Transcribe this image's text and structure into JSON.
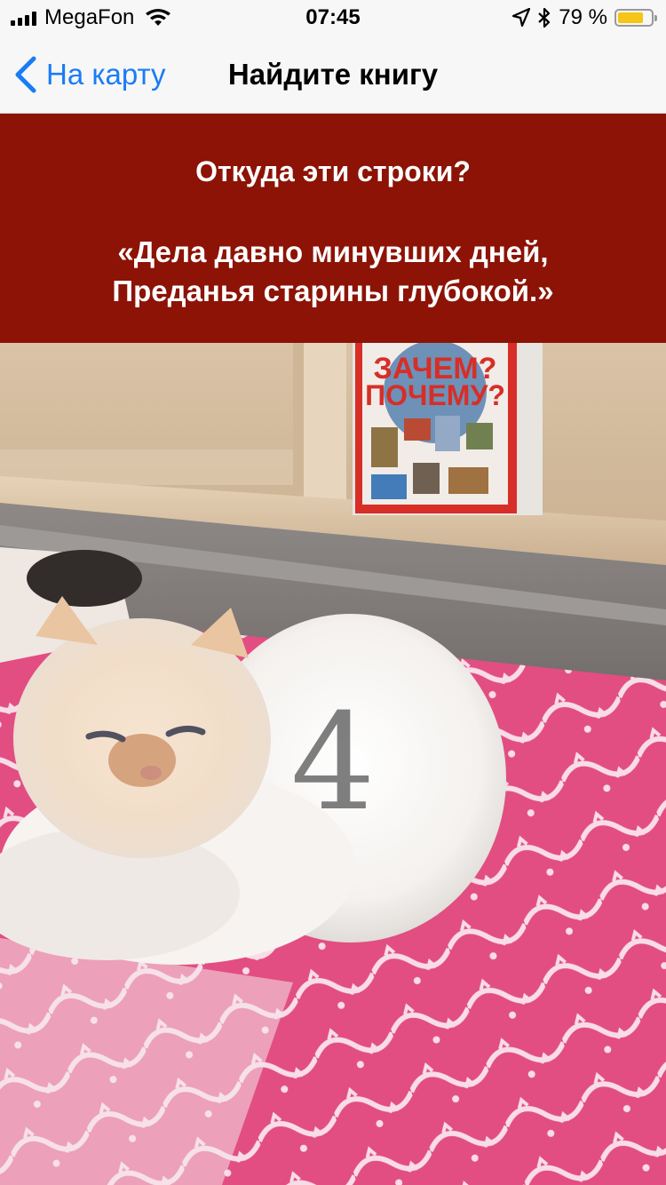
{
  "status_bar": {
    "carrier": "MegaFon",
    "time": "07:45",
    "battery_percent": "79 %",
    "battery_level": 0.79,
    "battery_color": "#f5c518"
  },
  "nav": {
    "back_label": "На карту",
    "title": "Найдите книгу",
    "accent_color": "#1a7cf5"
  },
  "question": {
    "title": "Откуда эти строки?",
    "quote_line1": "«Дела давно минувших дней,",
    "quote_line2": "Преданья старины глубокой.»",
    "banner_color": "#8c1306"
  },
  "photo": {
    "book_title": "ЗАЧЕМ? ПОЧЕМУ?",
    "overlay_number": "4"
  }
}
